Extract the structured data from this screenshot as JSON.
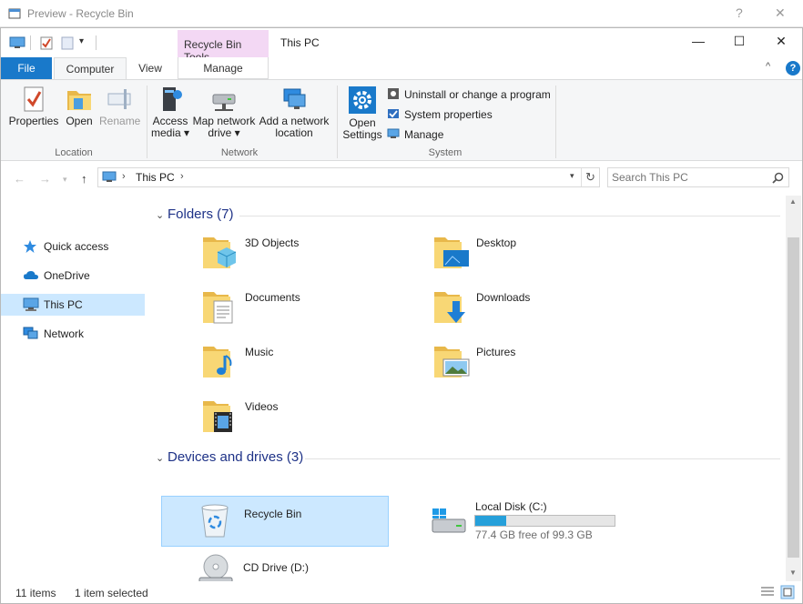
{
  "back_window": {
    "title": "Preview - Recycle Bin",
    "help": "?",
    "close": "✕"
  },
  "window": {
    "title": "This PC",
    "context_tab": "Recycle Bin Tools",
    "caption": {
      "minimize": "—",
      "maximize": "☐",
      "close": "✕"
    }
  },
  "tabs": {
    "file": "File",
    "computer": "Computer",
    "view": "View",
    "manage": "Manage"
  },
  "ribbon": {
    "location": {
      "label": "Location",
      "properties": "Properties",
      "open": "Open",
      "rename": "Rename"
    },
    "network": {
      "label": "Network",
      "access_media_1": "Access",
      "access_media_2": "media ▾",
      "map_drive_1": "Map network",
      "map_drive_2": "drive ▾",
      "add_location_1": "Add a network",
      "add_location_2": "location"
    },
    "system": {
      "label": "System",
      "open_settings_1": "Open",
      "open_settings_2": "Settings",
      "uninstall": "Uninstall or change a program",
      "properties": "System properties",
      "manage": "Manage"
    }
  },
  "address": {
    "path": "This PC",
    "search_placeholder": "Search This PC"
  },
  "nav": {
    "quick_access": "Quick access",
    "onedrive": "OneDrive",
    "this_pc": "This PC",
    "network": "Network"
  },
  "folders": {
    "heading": "Folders (7)",
    "items": [
      "3D Objects",
      "Desktop",
      "Documents",
      "Downloads",
      "Music",
      "Pictures",
      "Videos"
    ]
  },
  "drives": {
    "heading": "Devices and drives (3)",
    "recycle": "Recycle Bin",
    "local_disk": "Local Disk (C:)",
    "local_disk_free": "77.4 GB free of 99.3 GB",
    "local_disk_used_fraction": 0.22,
    "cd": "CD Drive (D:)"
  },
  "status": {
    "items": "11 items",
    "selected": "1 item selected"
  },
  "colors": {
    "accent": "#1979ca",
    "selection": "#cce8ff",
    "context_tab": "#f3d8f4",
    "heading": "#1e3287",
    "folder": "#f8d775"
  }
}
